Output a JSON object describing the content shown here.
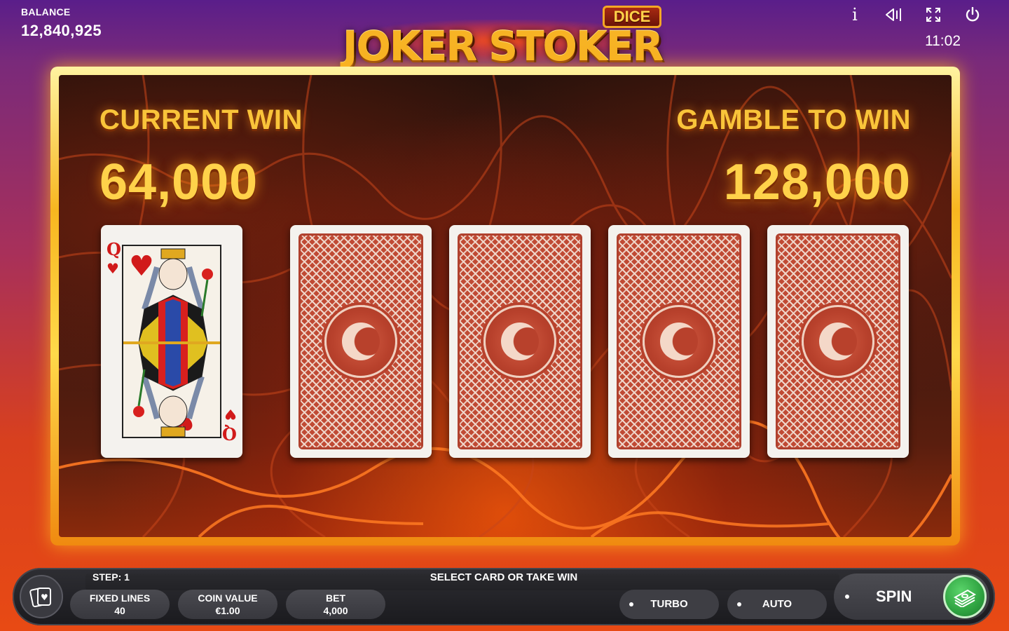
{
  "header": {
    "balance_label": "BALANCE",
    "balance_value": "12,840,925",
    "logo_main": "JOKER STOKER",
    "logo_badge": "DICE",
    "clock": "11:02",
    "icons": [
      "info-icon",
      "sound-icon",
      "fullscreen-icon",
      "power-icon"
    ],
    "icon_glyphs": {
      "info": "i",
      "sound": "◁|",
      "fullscreen": "⛶",
      "power": "⏻"
    }
  },
  "gamble": {
    "current_win_label": "CURRENT WIN",
    "current_win_value": "64,000",
    "gamble_to_win_label": "GAMBLE TO WIN",
    "gamble_to_win_value": "128,000",
    "dealer_card": {
      "rank": "Q",
      "suit": "hearts",
      "suit_glyph": "♥"
    },
    "face_down_cards": 4
  },
  "bottom_bar": {
    "step_label": "STEP: 1",
    "status_text": "SELECT CARD OR TAKE WIN",
    "fixed_lines_label": "FIXED LINES",
    "fixed_lines_value": "40",
    "coin_value_label": "COIN VALUE",
    "coin_value_value": "€1.00",
    "bet_label": "BET",
    "bet_value": "4,000",
    "turbo_label": "TURBO",
    "auto_label": "AUTO",
    "spin_label": "SPIN"
  },
  "colors": {
    "accent_gold": "#f9c43a",
    "card_back_red": "#c04a34",
    "spin_green": "#2ea240",
    "bar_dark": "#1a1a1e"
  }
}
